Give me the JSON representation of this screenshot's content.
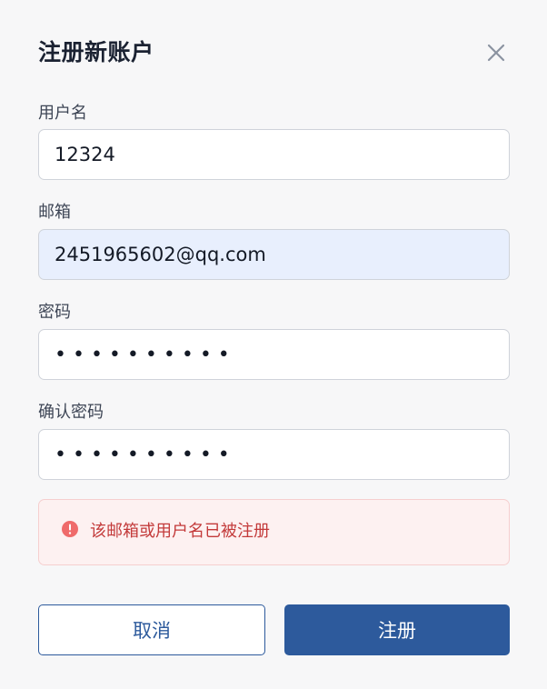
{
  "dialog": {
    "title": "注册新账户",
    "close_icon": "close-icon"
  },
  "form": {
    "username": {
      "label": "用户名",
      "value": "12324"
    },
    "email": {
      "label": "邮箱",
      "value": "2451965602@qq.com"
    },
    "password": {
      "label": "密码",
      "value": "••••••••••"
    },
    "confirm_password": {
      "label": "确认密码",
      "value": "••••••••••"
    }
  },
  "error": {
    "icon": "alert-circle-icon",
    "message": "该邮箱或用户名已被注册",
    "color": "#c33a3a"
  },
  "buttons": {
    "cancel_label": "取消",
    "submit_label": "注册"
  },
  "colors": {
    "primary": "#2d5a9c",
    "error_bg": "#fdf1f1",
    "autofill_bg": "#e8effd"
  }
}
